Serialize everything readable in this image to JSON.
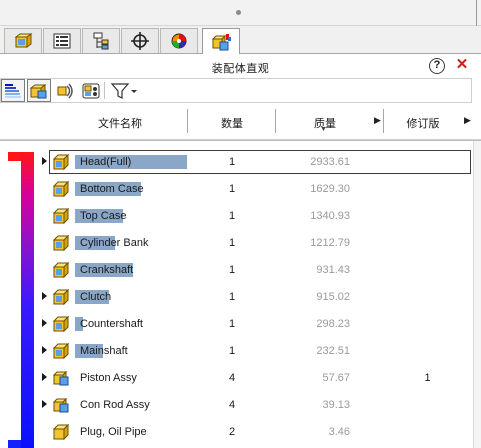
{
  "window": {
    "title": "装配体直观"
  },
  "tabs": [
    {
      "icon": "feature-manager-icon",
      "active": false
    },
    {
      "icon": "property-manager-icon",
      "active": false
    },
    {
      "icon": "configuration-manager-icon",
      "active": false
    },
    {
      "icon": "dimxpert-manager-icon",
      "active": false
    },
    {
      "icon": "display-manager-icon",
      "active": false
    },
    {
      "icon": "assembly-visualization-icon",
      "active": true
    }
  ],
  "toolbar": {
    "buttons": [
      "gradient-list-icon",
      "assembly-icon",
      "nested-view-icon",
      "grouping-icon"
    ],
    "filter_icon": "filter-icon"
  },
  "columns": {
    "name": "文件名称",
    "qty": "数量",
    "mass": "质量",
    "revision": "修订版"
  },
  "rows": [
    {
      "name": "Head(Full)",
      "qty": "1",
      "mass": "2933.61",
      "rev": "",
      "expandable": true,
      "icon": "part-icon",
      "selected": true
    },
    {
      "name": "Bottom Case",
      "qty": "1",
      "mass": "1629.30",
      "rev": "",
      "expandable": false,
      "icon": "part-icon",
      "selected": false
    },
    {
      "name": "Top Case",
      "qty": "1",
      "mass": "1340.93",
      "rev": "",
      "expandable": false,
      "icon": "part-icon",
      "selected": false
    },
    {
      "name": "Cylinder Bank",
      "qty": "1",
      "mass": "1212.79",
      "rev": "",
      "expandable": false,
      "icon": "part-icon",
      "selected": false
    },
    {
      "name": "Crankshaft",
      "qty": "1",
      "mass": "931.43",
      "rev": "",
      "expandable": false,
      "icon": "part-icon",
      "selected": false
    },
    {
      "name": "Clutch",
      "qty": "1",
      "mass": "915.02",
      "rev": "",
      "expandable": true,
      "icon": "part-icon",
      "selected": false
    },
    {
      "name": "Countershaft",
      "qty": "1",
      "mass": "298.23",
      "rev": "",
      "expandable": true,
      "icon": "part-icon",
      "selected": false
    },
    {
      "name": "Mainshaft",
      "qty": "1",
      "mass": "232.51",
      "rev": "",
      "expandable": true,
      "icon": "part-icon",
      "selected": false
    },
    {
      "name": "Piston Assy",
      "qty": "4",
      "mass": "57.67",
      "rev": "1",
      "expandable": true,
      "icon": "subassembly-icon",
      "selected": false
    },
    {
      "name": "Con Rod Assy",
      "qty": "4",
      "mass": "39.13",
      "rev": "",
      "expandable": true,
      "icon": "subassembly-icon",
      "selected": false
    },
    {
      "name": "Plug, Oil Pipe",
      "qty": "2",
      "mass": "3.46",
      "rev": "",
      "expandable": false,
      "icon": "part-icon",
      "selected": false
    }
  ],
  "colors": {
    "highlight": "#8aa7c8",
    "close": "#d21c1c",
    "ribbon_top": "#ff1515",
    "ribbon_bottom": "#0a10ff"
  }
}
